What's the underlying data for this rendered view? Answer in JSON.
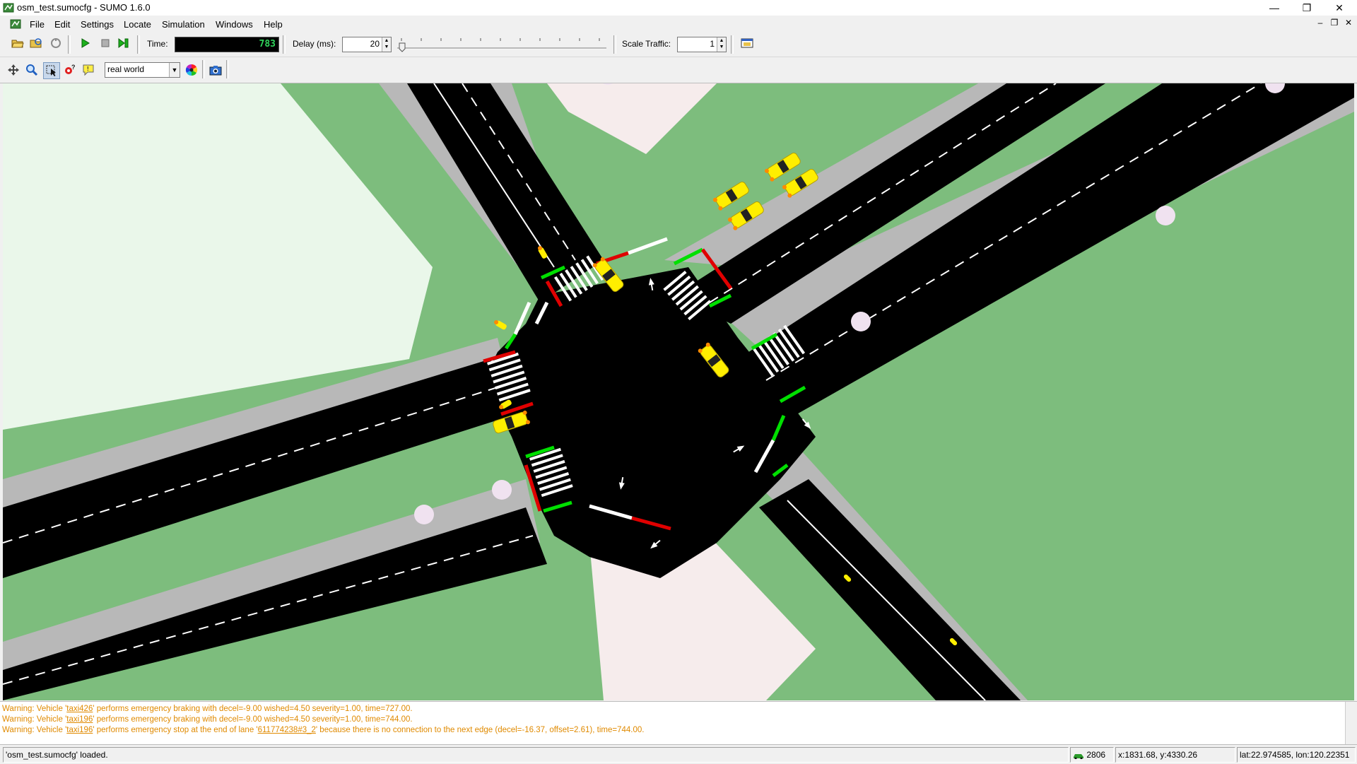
{
  "window": {
    "title": "osm_test.sumocfg - SUMO 1.6.0",
    "minimize_glyph": "—",
    "restore_glyph": "❐",
    "close_glyph": "✕"
  },
  "menu": {
    "items": [
      "File",
      "Edit",
      "Settings",
      "Locate",
      "Simulation",
      "Windows",
      "Help"
    ],
    "mdi_minimize_glyph": "–",
    "mdi_restore_glyph": "❐",
    "mdi_close_glyph": "✕"
  },
  "toolbar": {
    "time_label": "Time:",
    "time_value": "783",
    "delay_label": "Delay (ms):",
    "delay_value": "20",
    "scale_label": "Scale Traffic:",
    "scale_value": "1",
    "icons": [
      "open-file-icon",
      "reload-icon",
      "close-sim-icon",
      "run-icon",
      "stop-icon",
      "step-icon"
    ]
  },
  "view_toolbar": {
    "scheme_value": "real world",
    "icons": [
      "recenter-icon",
      "zoom-icon",
      "select-icon",
      "locate-icon",
      "tooltip-icon",
      "color-wheel-icon",
      "screenshot-icon"
    ]
  },
  "log": {
    "lines": [
      {
        "a": "Warning: Vehicle '",
        "link": "taxi426",
        "b": "' performs emergency braking with decel=-9.00 wished=4.50 severity=1.00, time=727.00."
      },
      {
        "a": "Warning: Vehicle '",
        "link": "taxi196",
        "b": "' performs emergency braking with decel=-9.00 wished=4.50 severity=1.00, time=744.00."
      },
      {
        "a": "Warning: Vehicle '",
        "link": "taxi196",
        "b": "' performs emergency stop at the end of lane '",
        "link2": "611774238#3_2",
        "c": "' because there is no connection to the next edge (decel=-16.37, offset=2.61), time=744.00."
      }
    ]
  },
  "status": {
    "message": "'osm_test.sumocfg' loaded.",
    "vehicle_count": "2806",
    "coords": "x:1831.68, y:4330.26",
    "latlon": "lat:22.974585, lon:120.22351"
  },
  "colors": {
    "grass": "#7dbd7d",
    "road": "#000000",
    "sidewalk": "#b8b8b8",
    "vehicle": "#ffee00",
    "signal_green": "#00e000",
    "signal_red": "#e00000",
    "warning_text": "#e08a00"
  }
}
